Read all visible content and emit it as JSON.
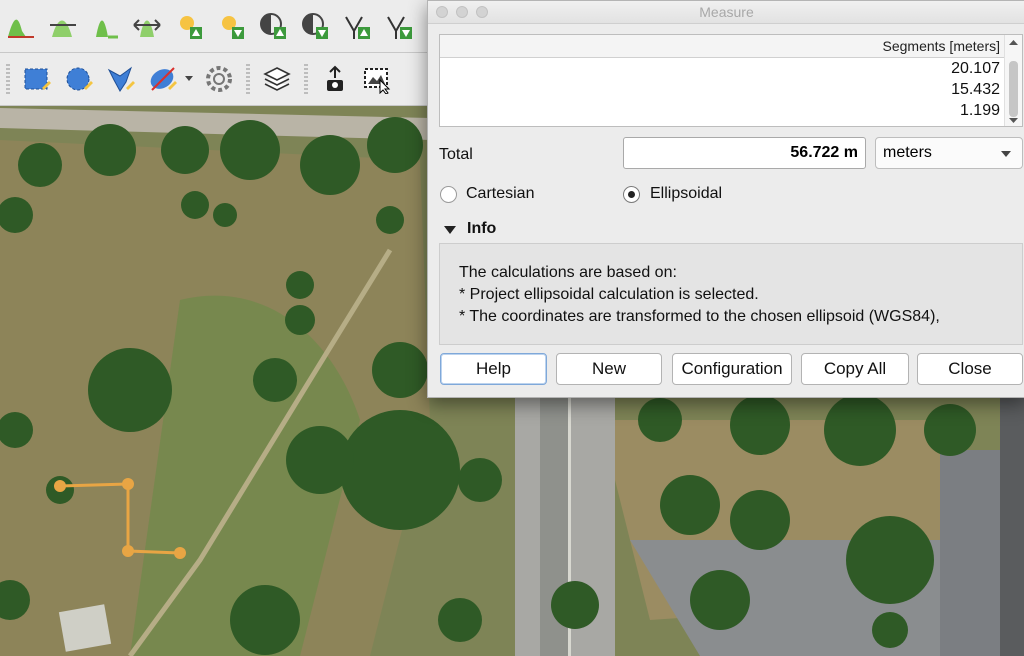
{
  "dialog": {
    "title": "Measure",
    "segments_header": "Segments [meters]",
    "segments": [
      "20.107",
      "15.432",
      "1.199"
    ],
    "total_label": "Total",
    "total_value": "56.722 m",
    "units_selected": "meters",
    "radio_cartesian": "Cartesian",
    "radio_ellipsoidal": "Ellipsoidal",
    "selected_mode": "Ellipsoidal",
    "info_header": "Info",
    "info_lines": [
      "The calculations are based on:",
      "* Project ellipsoidal calculation is selected.",
      "* The coordinates are transformed to the chosen ellipsoid (WGS84),"
    ],
    "buttons": {
      "help": "Help",
      "new": "New",
      "configuration": "Configuration",
      "copy_all": "Copy All",
      "close": "Close"
    }
  },
  "toolbar_top_icons": [
    "histogram-icon",
    "stretch-histogram-icon",
    "cumulative-cut-icon",
    "stretch-icon",
    "brightness-increase-icon",
    "brightness-decrease-icon",
    "contrast-increase-icon",
    "contrast-decrease-icon",
    "gamma-increase-icon",
    "gamma-decrease-icon"
  ],
  "toolbar_bottom_icons": [
    "select-rectangle-icon",
    "select-circle-icon",
    "select-freehand-icon",
    "deselect-icon",
    "settings-icon",
    "layers-icon",
    "export-map-icon",
    "save-image-icon"
  ],
  "colors": {
    "measure_line": "#e8a544",
    "accent": "#4a90e2"
  }
}
